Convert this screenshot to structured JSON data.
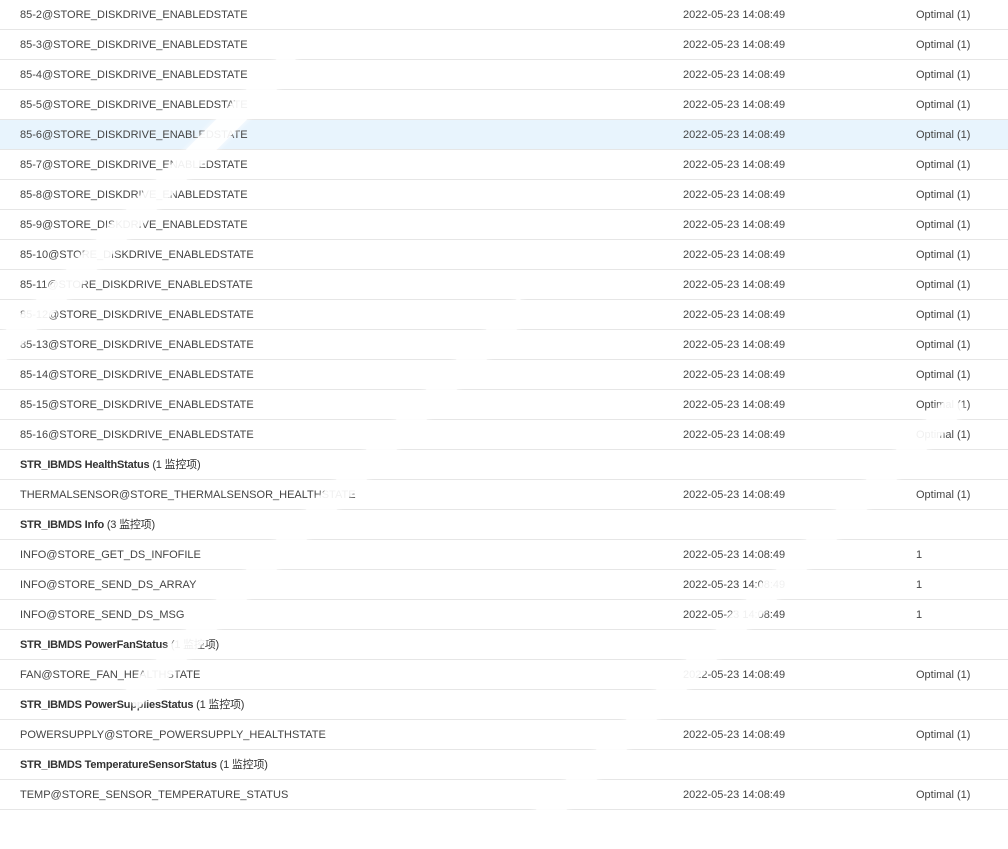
{
  "rows": [
    {
      "type": "item",
      "name": "85-2@STORE_DISKDRIVE_ENABLEDSTATE",
      "time": "2022-05-23 14:08:49",
      "status": "Optimal (1)"
    },
    {
      "type": "item",
      "name": "85-3@STORE_DISKDRIVE_ENABLEDSTATE",
      "time": "2022-05-23 14:08:49",
      "status": "Optimal (1)"
    },
    {
      "type": "item",
      "name": "85-4@STORE_DISKDRIVE_ENABLEDSTATE",
      "time": "2022-05-23 14:08:49",
      "status": "Optimal (1)"
    },
    {
      "type": "item",
      "name": "85-5@STORE_DISKDRIVE_ENABLEDSTATE",
      "time": "2022-05-23 14:08:49",
      "status": "Optimal (1)"
    },
    {
      "type": "item",
      "name": "85-6@STORE_DISKDRIVE_ENABLEDSTATE",
      "time": "2022-05-23 14:08:49",
      "status": "Optimal (1)",
      "highlight": true
    },
    {
      "type": "item",
      "name": "85-7@STORE_DISKDRIVE_ENABLEDSTATE",
      "time": "2022-05-23 14:08:49",
      "status": "Optimal (1)"
    },
    {
      "type": "item",
      "name": "85-8@STORE_DISKDRIVE_ENABLEDSTATE",
      "time": "2022-05-23 14:08:49",
      "status": "Optimal (1)"
    },
    {
      "type": "item",
      "name": "85-9@STORE_DISKDRIVE_ENABLEDSTATE",
      "time": "2022-05-23 14:08:49",
      "status": "Optimal (1)"
    },
    {
      "type": "item",
      "name": "85-10@STORE_DISKDRIVE_ENABLEDSTATE",
      "time": "2022-05-23 14:08:49",
      "status": "Optimal (1)"
    },
    {
      "type": "item",
      "name": "85-11@STORE_DISKDRIVE_ENABLEDSTATE",
      "time": "2022-05-23 14:08:49",
      "status": "Optimal (1)"
    },
    {
      "type": "item",
      "name": "85-12@STORE_DISKDRIVE_ENABLEDSTATE",
      "time": "2022-05-23 14:08:49",
      "status": "Optimal (1)"
    },
    {
      "type": "item",
      "name": "85-13@STORE_DISKDRIVE_ENABLEDSTATE",
      "time": "2022-05-23 14:08:49",
      "status": "Optimal (1)"
    },
    {
      "type": "item",
      "name": "85-14@STORE_DISKDRIVE_ENABLEDSTATE",
      "time": "2022-05-23 14:08:49",
      "status": "Optimal (1)"
    },
    {
      "type": "item",
      "name": "85-15@STORE_DISKDRIVE_ENABLEDSTATE",
      "time": "2022-05-23 14:08:49",
      "status": "Optimal (1)"
    },
    {
      "type": "item",
      "name": "85-16@STORE_DISKDRIVE_ENABLEDSTATE",
      "time": "2022-05-23 14:08:49",
      "status": "Optimal (1)"
    },
    {
      "type": "group",
      "name": "STR_IBMDS HealthStatus",
      "count": "(1 监控项)"
    },
    {
      "type": "item",
      "name": "THERMALSENSOR@STORE_THERMALSENSOR_HEALTHSTATE",
      "time": "2022-05-23 14:08:49",
      "status": "Optimal (1)"
    },
    {
      "type": "group",
      "name": "STR_IBMDS Info",
      "count": "(3 监控项)"
    },
    {
      "type": "item",
      "name": "INFO@STORE_GET_DS_INFOFILE",
      "time": "2022-05-23 14:08:49",
      "status": "1"
    },
    {
      "type": "item",
      "name": "INFO@STORE_SEND_DS_ARRAY",
      "time": "2022-05-23 14:08:49",
      "status": "1"
    },
    {
      "type": "item",
      "name": "INFO@STORE_SEND_DS_MSG",
      "time": "2022-05-23 14:08:49",
      "status": "1"
    },
    {
      "type": "group",
      "name": "STR_IBMDS PowerFanStatus",
      "count": "(1 监控项)"
    },
    {
      "type": "item",
      "name": "FAN@STORE_FAN_HEALTHSTATE",
      "time": "2022-05-23 14:08:49",
      "status": "Optimal (1)"
    },
    {
      "type": "group",
      "name": "STR_IBMDS PowerSuppliesStatus",
      "count": "(1 监控项)"
    },
    {
      "type": "item",
      "name": "POWERSUPPLY@STORE_POWERSUPPLY_HEALTHSTATE",
      "time": "2022-05-23 14:08:49",
      "status": "Optimal (1)"
    },
    {
      "type": "group",
      "name": "STR_IBMDS TemperatureSensorStatus",
      "count": "(1 监控项)"
    },
    {
      "type": "item",
      "name": "TEMP@STORE_SENSOR_TEMPERATURE_STATUS",
      "time": "2022-05-23 14:08:49",
      "status": "Optimal (1)"
    }
  ]
}
